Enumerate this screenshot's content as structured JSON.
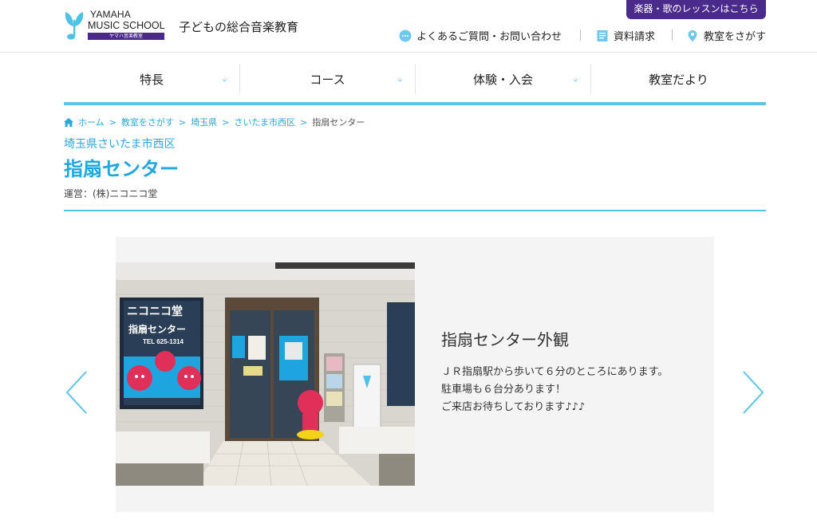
{
  "header": {
    "brand_line1": "YAMAHA",
    "brand_line2": "MUSIC SCHOOL",
    "brand_sub": "ヤマハ音楽教室",
    "tagline": "子どもの総合音楽教育",
    "lesson_button": "楽器・歌のレッスンはこちら",
    "links": {
      "faq": "よくあるご質問・お問い合わせ",
      "brochure": "資料請求",
      "find": "教室をさがす"
    },
    "icons": {
      "faq": "chat-bubble-icon",
      "brochure": "document-icon",
      "find": "map-pin-icon"
    }
  },
  "nav": {
    "items": [
      {
        "label": "特長"
      },
      {
        "label": "コース"
      },
      {
        "label": "体験・入会"
      },
      {
        "label": "教室だより"
      }
    ]
  },
  "breadcrumb": {
    "home": "ホーム",
    "items": [
      "教室をさがす",
      "埼玉県",
      "さいたま市西区"
    ],
    "current": "指扇センター",
    "separator": ">"
  },
  "page": {
    "area": "埼玉県さいたま市西区",
    "title": "指扇センター",
    "operator": "運営：(株)ニコニコ堂"
  },
  "slide": {
    "title": "指扇センター外観",
    "lines": [
      "ＪＲ指扇駅から歩いて６分のところにあります。",
      "駐車場も６台分あります！",
      "ご来店お待ちしております♪♪♪"
    ],
    "photo": {
      "sign1": "ニコニコ堂",
      "sign2": "指扇センター",
      "sign3": "TEL 625-1314"
    }
  },
  "colors": {
    "accent": "#5bc4e6",
    "title_blue": "#1fa7e0",
    "brand_purple": "#4a2a8a"
  }
}
